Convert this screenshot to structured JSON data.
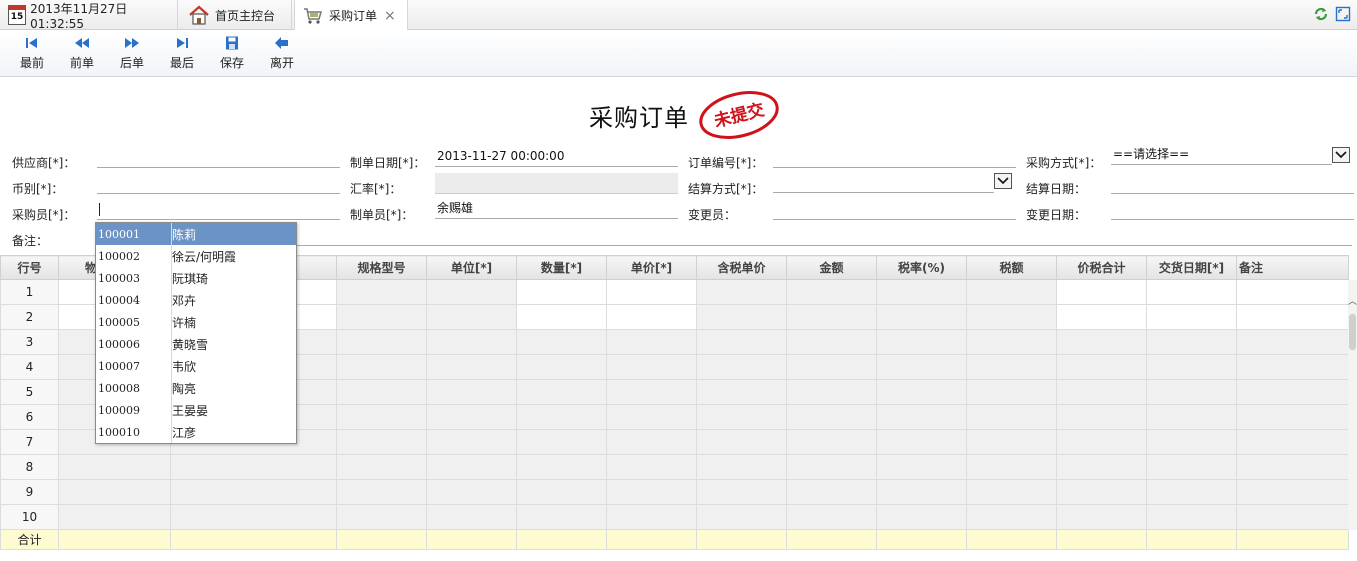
{
  "tabs": {
    "clock_icon_day": "15",
    "datetime": "2013年11月27日 01:32:55",
    "home_label": "首页主控台",
    "order_label": "采购订单",
    "close_glyph": "×"
  },
  "toolbar": {
    "first": "最前",
    "prev": "前单",
    "next": "后单",
    "last": "最后",
    "save": "保存",
    "leave": "离开"
  },
  "form": {
    "title": "采购订单",
    "stamp": "未提交",
    "supplier_label": "供应商[*]：",
    "supplier_value": "",
    "created_date_label": "制单日期[*]：",
    "created_date_value": "2013-11-27 00:00:00",
    "order_no_label": "订单编号[*]：",
    "order_no_value": "",
    "purchase_method_label": "采购方式[*]：",
    "purchase_method_value": "==请选择==",
    "currency_label": "币别[*]：",
    "currency_value": "",
    "exchange_rate_label": "汇率[*]：",
    "exchange_rate_value": "",
    "settlement_method_label": "结算方式[*]：",
    "settlement_method_value": "",
    "settlement_date_label": "结算日期：",
    "settlement_date_value": "",
    "buyer_label": "采购员[*]：",
    "buyer_value": "",
    "creator_label": "制单员[*]：",
    "creator_value": "余赐雄",
    "changer_label": "变更员：",
    "changer_value": "",
    "change_date_label": "变更日期：",
    "change_date_value": "",
    "remark_label": "备注：",
    "remark_value": ""
  },
  "grid": {
    "columns": [
      "行号",
      "物",
      "",
      "规格型号",
      "单位[*]",
      "数量[*]",
      "单价[*]",
      "含税单价",
      "金额",
      "税率(%)",
      "税额",
      "价税合计",
      "交货日期[*]",
      "备注"
    ],
    "row_numbers": [
      "1",
      "2",
      "3",
      "4",
      "5",
      "6",
      "7",
      "8",
      "9",
      "10"
    ],
    "total_label": "合计"
  },
  "dropdown": {
    "items": [
      {
        "code": "100001",
        "name": "陈莉",
        "selected": true
      },
      {
        "code": "100002",
        "name": "徐云/何明霞",
        "selected": false
      },
      {
        "code": "100003",
        "name": "阮琪琦",
        "selected": false
      },
      {
        "code": "100004",
        "name": "邓卉",
        "selected": false
      },
      {
        "code": "100005",
        "name": "许楠",
        "selected": false
      },
      {
        "code": "100006",
        "name": "黄晓雪",
        "selected": false
      },
      {
        "code": "100007",
        "name": "韦欣",
        "selected": false
      },
      {
        "code": "100008",
        "name": "陶亮",
        "selected": false
      },
      {
        "code": "100009",
        "name": "王晏晏",
        "selected": false
      },
      {
        "code": "100010",
        "name": "江彦",
        "selected": false
      }
    ]
  },
  "colors": {
    "accent_blue": "#2a6fc9",
    "stamp_red": "#d0121b",
    "selected_row": "#6b93c6",
    "total_row": "#fffbd1"
  }
}
